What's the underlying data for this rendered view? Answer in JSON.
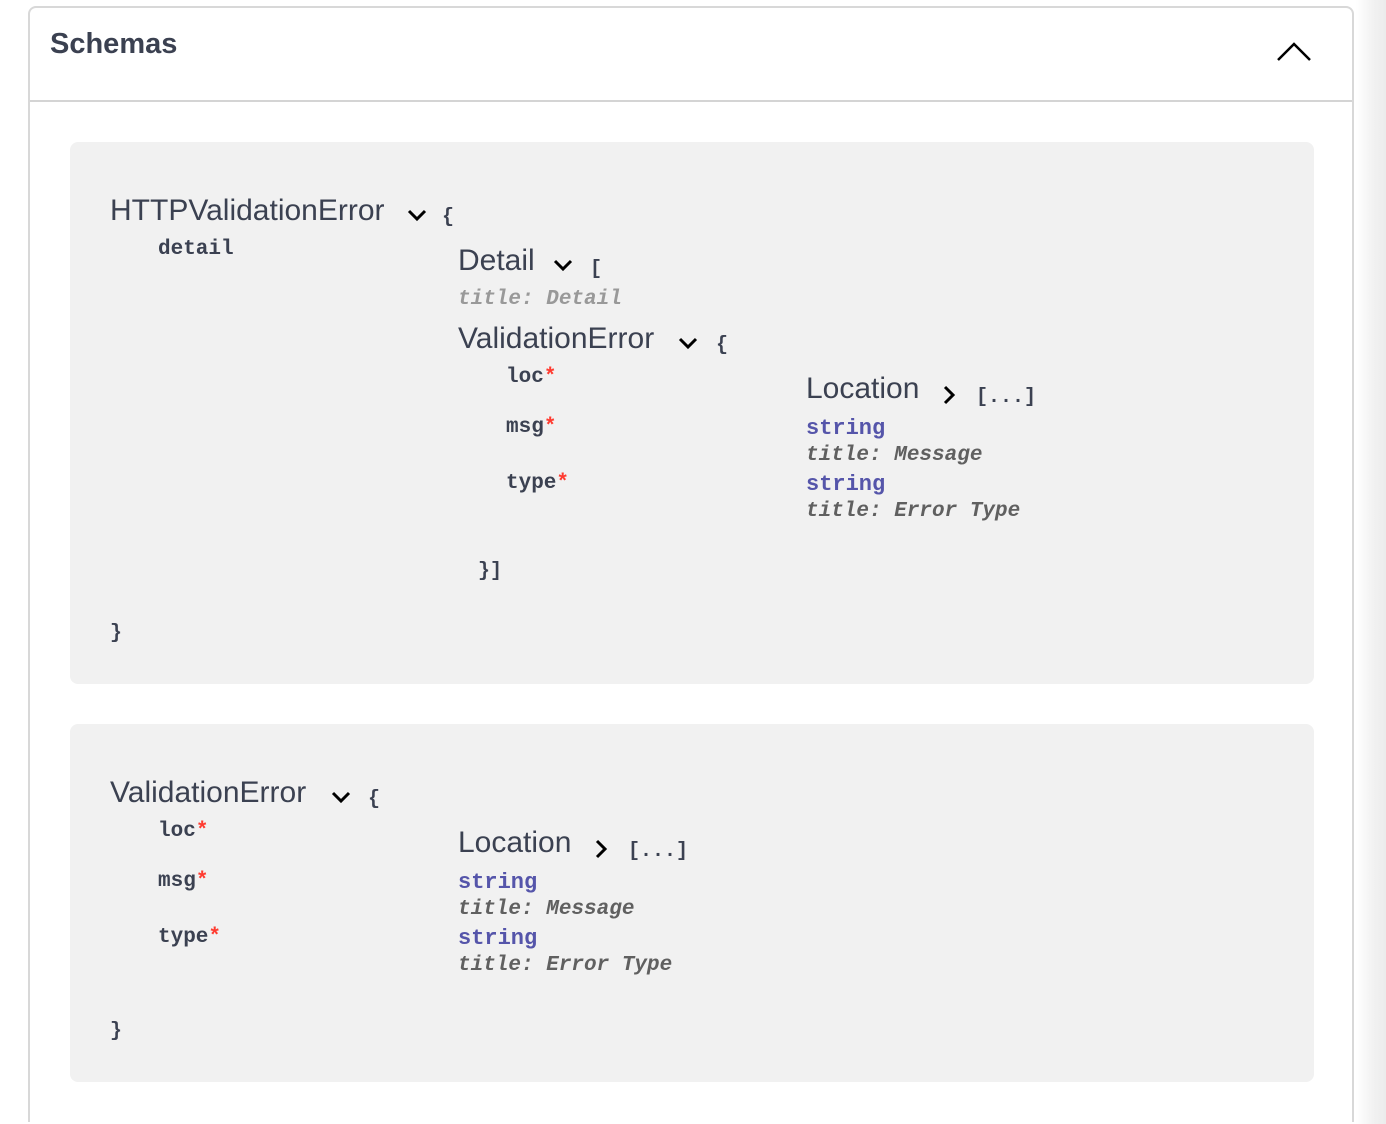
{
  "section": {
    "title": "Schemas",
    "collapse_icon": "chevron-up-icon"
  },
  "models": [
    {
      "name": "HTTPValidationError",
      "open_brace": "{",
      "close_brace": "}",
      "property": {
        "name": "detail",
        "array_title": "Detail",
        "array_open": "[",
        "array_title_label": "title: Detail",
        "item": {
          "name": "ValidationError",
          "open_brace": "{",
          "close": "}]",
          "properties": [
            {
              "name": "loc",
              "required": "*",
              "type_title": "Location",
              "collapsed": "[...]"
            },
            {
              "name": "msg",
              "required": "*",
              "type": "string",
              "title": "title: Message"
            },
            {
              "name": "type",
              "required": "*",
              "type": "string",
              "title": "title: Error Type"
            }
          ]
        }
      }
    },
    {
      "name": "ValidationError",
      "open_brace": "{",
      "close_brace": "}",
      "properties": [
        {
          "name": "loc",
          "required": "*",
          "type_title": "Location",
          "collapsed": "[...]"
        },
        {
          "name": "msg",
          "required": "*",
          "type": "string",
          "title": "title: Message"
        },
        {
          "name": "type",
          "required": "*",
          "type": "string",
          "title": "title: Error Type"
        }
      ]
    }
  ],
  "colors": {
    "text": "#3b4151",
    "required": "#ff3b30",
    "type": "#5555aa",
    "model_bg": "#f1f1f1"
  }
}
